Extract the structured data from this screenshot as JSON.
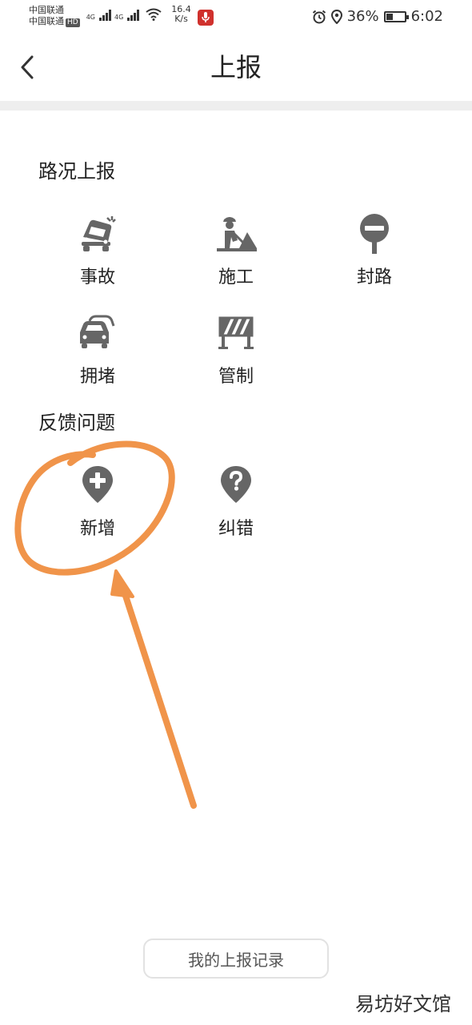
{
  "status_bar": {
    "carrier1": "中国联通",
    "carrier2": "中国联通",
    "hd": "HD",
    "net1": "4G",
    "net2": "4G",
    "speed_value": "16.4",
    "speed_unit": "K/s",
    "battery": "36%",
    "time": "6:02",
    "battery_level": 0.36
  },
  "header": {
    "title": "上报"
  },
  "road_report": {
    "title": "路况上报",
    "items": [
      {
        "label": "事故",
        "icon": "car-crash-icon"
      },
      {
        "label": "施工",
        "icon": "construction-worker-icon"
      },
      {
        "label": "封路",
        "icon": "no-entry-pin-icon"
      },
      {
        "label": "拥堵",
        "icon": "traffic-jam-icon"
      },
      {
        "label": "管制",
        "icon": "barrier-icon"
      }
    ]
  },
  "feedback": {
    "title": "反馈问题",
    "items": [
      {
        "label": "新增",
        "icon": "add-pin-icon"
      },
      {
        "label": "纠错",
        "icon": "question-pin-icon"
      }
    ]
  },
  "records_button": "我的上报记录",
  "watermark": "易坊好文馆",
  "colors": {
    "icon": "#666666",
    "annotation": "#f0944a",
    "mic_badge": "#d0312d"
  }
}
